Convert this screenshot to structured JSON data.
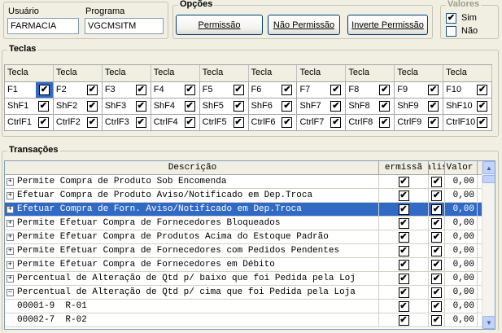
{
  "user": {
    "label": "Usuário",
    "value": "FARMACIA"
  },
  "program": {
    "label": "Programa",
    "value": "VGCMSITM"
  },
  "options": {
    "title": "Opções",
    "permissao": "Permissão",
    "nao_permissao": "Não Permissão",
    "inverte_permissao": "Inverte Permissão"
  },
  "valores": {
    "title": "Valores",
    "sim": "Sim",
    "nao": "Não",
    "sim_checked": true,
    "nao_checked": false
  },
  "teclas": {
    "title": "Teclas",
    "header": [
      "Tecla",
      "Tecla",
      "Tecla",
      "Tecla",
      "Tecla",
      "Tecla",
      "Tecla",
      "Tecla",
      "Tecla",
      "Tecla"
    ],
    "rows": [
      [
        "F1",
        "F2",
        "F3",
        "F4",
        "F5",
        "F6",
        "F7",
        "F8",
        "F9",
        "F10"
      ],
      [
        "ShF1",
        "ShF2",
        "ShF3",
        "ShF4",
        "ShF5",
        "ShF6",
        "ShF7",
        "ShF8",
        "ShF9",
        "ShF10"
      ],
      [
        "CtrlF1",
        "CtrlF2",
        "CtrlF3",
        "CtrlF4",
        "CtrlF5",
        "CtrlF6",
        "CtrlF7",
        "CtrlF8",
        "CtrlF9",
        "CtrlF10"
      ]
    ]
  },
  "transacoes": {
    "title": "Transações",
    "columns": {
      "descricao": "Descrição",
      "permissao": "ermissã",
      "analise": "alis",
      "valor": "Valor"
    },
    "rows": [
      {
        "expander": "+",
        "desc": "Permite Compra de Produto Sob Encomenda",
        "valor": "0,00",
        "selected": false
      },
      {
        "expander": "+",
        "desc": "Efetuar Compra de Produto Aviso/Notificado em Dep.Troca",
        "valor": "0,00",
        "selected": false
      },
      {
        "expander": "+",
        "desc": "Efetuar Compra de Forn. Aviso/Notificado em Dep.Troca",
        "valor": "0,00",
        "selected": true
      },
      {
        "expander": "+",
        "desc": "Permite Efetuar Compra de Fornecedores Bloqueados",
        "valor": "0,00",
        "selected": false
      },
      {
        "expander": "+",
        "desc": "Permite Efetuar Compra de Produtos Acima do Estoque Padrão",
        "valor": "0,00",
        "selected": false
      },
      {
        "expander": "+",
        "desc": "Permite Efetuar Compra de Fornecedores com Pedidos Pendentes",
        "valor": "0,00",
        "selected": false
      },
      {
        "expander": "+",
        "desc": "Permite Efetuar Compra de Fornecedores em Débito",
        "valor": "0,00",
        "selected": false
      },
      {
        "expander": "+",
        "desc": "Percentual de Alteração de Qtd p/ baixo que foi Pedida pela Loj",
        "valor": "0,00",
        "selected": false
      },
      {
        "expander": "−",
        "desc": "Percentual de Alteração de Qtd p/ cima que foi Pedida pela Loja",
        "valor": "0,00",
        "selected": false
      },
      {
        "expander": "",
        "desc": "00001-9  R-01",
        "valor": "0,00",
        "selected": false
      },
      {
        "expander": "",
        "desc": "00002-7  R-02",
        "valor": "0,00",
        "selected": false
      }
    ]
  }
}
